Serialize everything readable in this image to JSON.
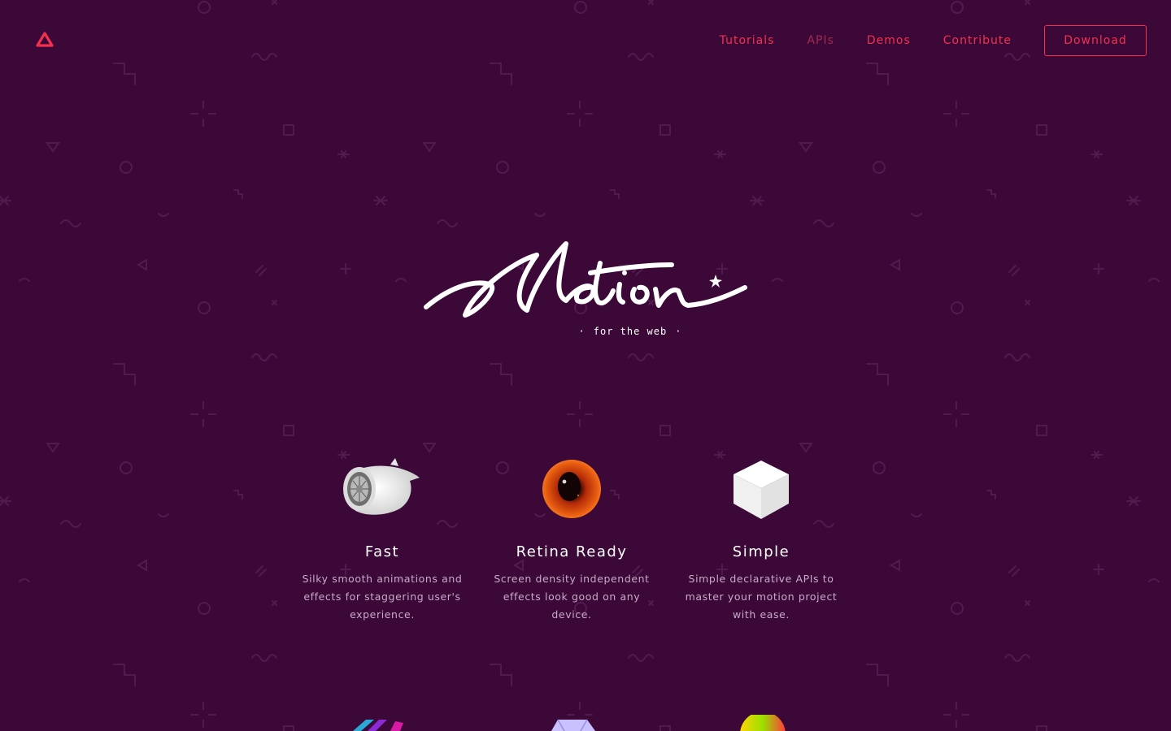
{
  "nav": {
    "links": [
      {
        "label": "Tutorials",
        "active": true
      },
      {
        "label": "APIs",
        "active": false
      },
      {
        "label": "Demos",
        "active": true
      },
      {
        "label": "Contribute",
        "active": true
      }
    ],
    "download_label": "Download"
  },
  "hero": {
    "wordmark": "Motion",
    "tagline": "for the web"
  },
  "features": [
    {
      "title": "Fast",
      "description": "Silky smooth animations and effects for staggering user's experience.",
      "icon": "jet-engine-icon"
    },
    {
      "title": "Retina Ready",
      "description": "Screen density independent effects look good on any device.",
      "icon": "eye-icon"
    },
    {
      "title": "Simple",
      "description": "Simple declarative APIs to master your motion project with ease.",
      "icon": "cube-icon"
    }
  ],
  "colors": {
    "background": "#3b0838",
    "accent": "#f2314f",
    "accent_muted": "#a42a4f",
    "text": "#ffffff",
    "text_secondary": "#c8aac6"
  }
}
